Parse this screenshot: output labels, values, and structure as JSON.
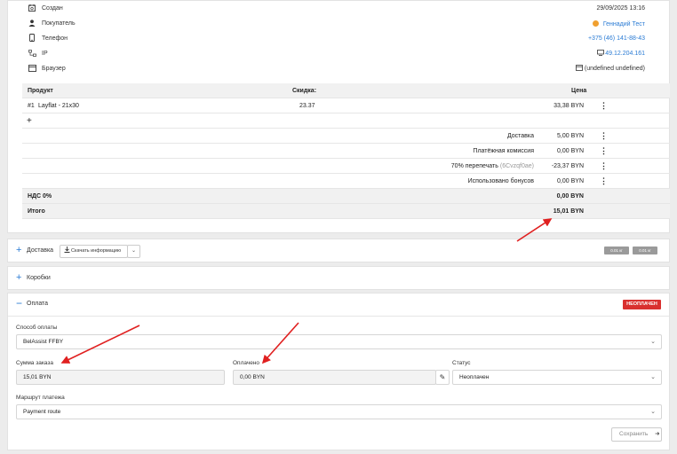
{
  "order_info": {
    "created": {
      "label": "Создан",
      "value": "29/09/2025 13:16",
      "icon": "calendar-clock-icon"
    },
    "buyer": {
      "label": "Покупатель",
      "value": "Геннадий Тест",
      "icon": "user-icon"
    },
    "phone": {
      "label": "Телефон",
      "value": "+375 (46) 141-88-43",
      "icon": "phone-icon"
    },
    "ip": {
      "label": "IP",
      "value": "49.12.204.161",
      "icon": "network-icon"
    },
    "browser": {
      "label": "Браузер",
      "value": "(undefined undefined)",
      "icon": "browser-icon"
    }
  },
  "products_table": {
    "headers": {
      "product": "Продукт",
      "discount": "Скидка:",
      "price": "Цена"
    },
    "rows": [
      {
        "num": "#1",
        "name": "Layflat - 21x30",
        "discount": "23.37",
        "price": "33,38 BYN"
      }
    ],
    "add_label": "+",
    "extras": [
      {
        "label": "Доставка",
        "value": "5,00 BYN"
      },
      {
        "label": "Платёжная комиссия",
        "value": "0,00 BYN"
      },
      {
        "label": "70% перепечать",
        "label_note": "(6Cvzqf0ae)",
        "value": "-23,37 BYN"
      },
      {
        "label": "Использовано бонусов",
        "value": "0,00 BYN"
      }
    ],
    "vat": {
      "label": "НДС 0%",
      "value": "0,00 BYN"
    },
    "total": {
      "label": "Итого",
      "value": "15,01 BYN"
    }
  },
  "delivery_section": {
    "title": "Доставка",
    "download_label": "Скачать информацию",
    "badges": [
      "0.01 кг",
      "0.01 кг"
    ]
  },
  "boxes_section": {
    "title": "Коробки"
  },
  "payment_section": {
    "title": "Оплата",
    "status_badge": "НЕОПЛАЧЕН",
    "method": {
      "label": "Способ оплаты",
      "value": "BelAssist FFBY"
    },
    "order_sum": {
      "label": "Сумма заказа",
      "value": "15,01 BYN"
    },
    "paid": {
      "label": "Оплачено",
      "value": "0,00 BYN"
    },
    "status": {
      "label": "Статус",
      "value": "Неоплачен"
    },
    "route": {
      "label": "Маршрут платежа",
      "value": "Payment route"
    },
    "save_label": "Сохранить"
  },
  "colors": {
    "accent": "#2a7bd4",
    "danger": "#d9302f",
    "arrow": "#e02020",
    "warning": "#f0a030"
  }
}
